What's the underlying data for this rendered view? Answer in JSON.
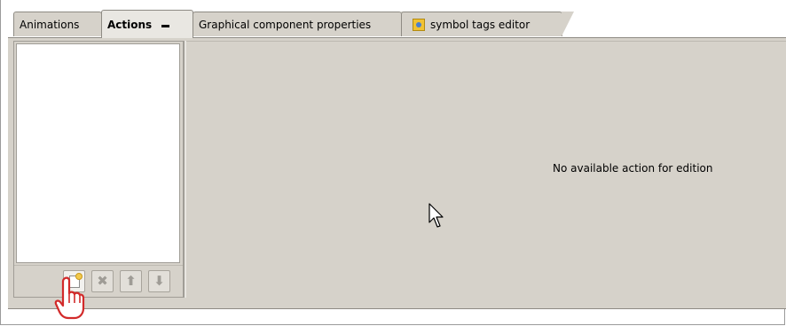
{
  "tabs": [
    {
      "label": "Animations",
      "active": false
    },
    {
      "label": "Actions",
      "active": true
    },
    {
      "label": "Graphical component properties",
      "active": false
    },
    {
      "label": "symbol tags editor",
      "active": false,
      "icon": "symbol-tags-icon"
    }
  ],
  "action_list": {
    "items": []
  },
  "toolbar": {
    "buttons": [
      {
        "name": "new-action",
        "icon": "new-document-icon",
        "enabled": true
      },
      {
        "name": "delete-action",
        "icon": "delete-x-icon",
        "enabled": false
      },
      {
        "name": "move-up",
        "icon": "arrow-up-icon",
        "enabled": false
      },
      {
        "name": "move-down",
        "icon": "arrow-down-icon",
        "enabled": false
      }
    ]
  },
  "editor": {
    "empty_message": "No available action for edition"
  },
  "colors": {
    "panel": "#d6d2ca",
    "border": "#8e8b84",
    "list_background": "#ffffff"
  }
}
